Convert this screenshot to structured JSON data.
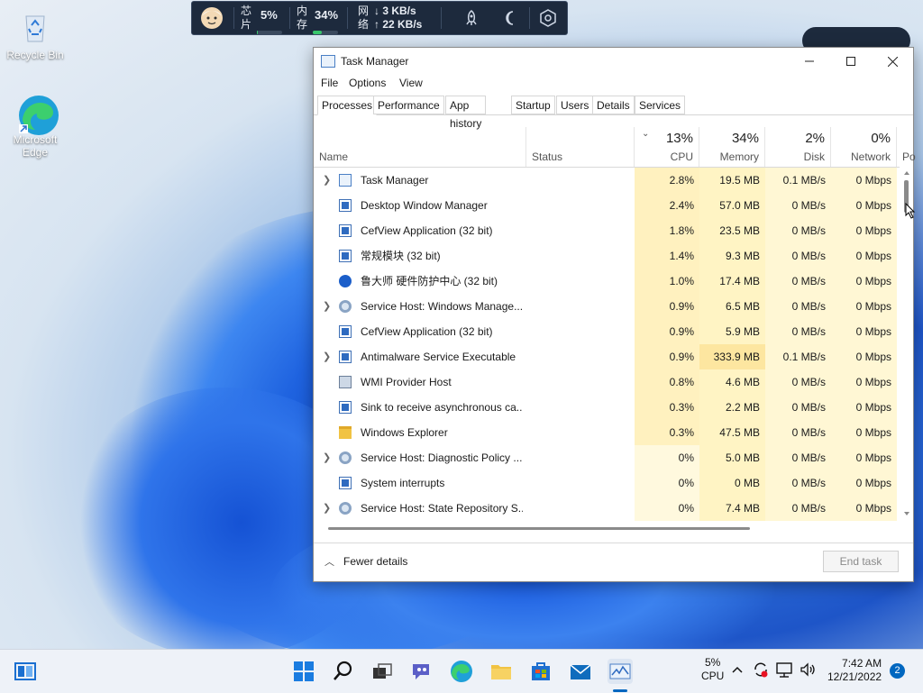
{
  "desktop": {
    "icons": [
      {
        "label": "Recycle Bin"
      },
      {
        "label": "Microsoft Edge"
      }
    ]
  },
  "monitor_bar": {
    "cpu_label_top": "芯",
    "cpu_label_bottom": "片",
    "cpu_value": "5%",
    "cpu_fraction": 0.05,
    "mem_label_top": "内",
    "mem_label_bottom": "存",
    "mem_value": "34%",
    "mem_fraction": 0.34,
    "net_label_top": "网",
    "net_label_bottom": "络",
    "net_down": "↓ 3 KB/s",
    "net_up": "↑ 22 KB/s",
    "icons": [
      "rocket-icon",
      "moon-icon",
      "settings-hex-icon"
    ]
  },
  "task_manager": {
    "title": "Task Manager",
    "menu": [
      "File",
      "Options",
      "View"
    ],
    "tabs": [
      "Processes",
      "Performance",
      "App history",
      "Startup",
      "Users",
      "Details",
      "Services"
    ],
    "active_tab": "Processes",
    "columns": {
      "name": "Name",
      "status": "Status",
      "cpu": {
        "pct": "13%",
        "label": "CPU"
      },
      "memory": {
        "pct": "34%",
        "label": "Memory"
      },
      "disk": {
        "pct": "2%",
        "label": "Disk"
      },
      "network": {
        "pct": "0%",
        "label": "Network"
      },
      "power_partial": "Po"
    },
    "processes": [
      {
        "name": "Task Manager",
        "cpu": "2.8%",
        "memory": "19.5 MB",
        "disk": "0.1 MB/s",
        "network": "0 Mbps",
        "expandable": true,
        "icon": "task-manager-icon"
      },
      {
        "name": "Desktop Window Manager",
        "cpu": "2.4%",
        "memory": "57.0 MB",
        "disk": "0 MB/s",
        "network": "0 Mbps",
        "expandable": false,
        "icon": "app-icon"
      },
      {
        "name": "CefView Application (32 bit)",
        "cpu": "1.8%",
        "memory": "23.5 MB",
        "disk": "0 MB/s",
        "network": "0 Mbps",
        "expandable": false,
        "icon": "app-icon"
      },
      {
        "name": "常规模块 (32 bit)",
        "cpu": "1.4%",
        "memory": "9.3 MB",
        "disk": "0 MB/s",
        "network": "0 Mbps",
        "expandable": false,
        "icon": "app-icon"
      },
      {
        "name": "鲁大师 硬件防护中心 (32 bit)",
        "cpu": "1.0%",
        "memory": "17.4 MB",
        "disk": "0 MB/s",
        "network": "0 Mbps",
        "expandable": false,
        "icon": "shield-icon"
      },
      {
        "name": "Service Host: Windows Manage...",
        "cpu": "0.9%",
        "memory": "6.5 MB",
        "disk": "0 MB/s",
        "network": "0 Mbps",
        "expandable": true,
        "icon": "gear-icon"
      },
      {
        "name": "CefView Application (32 bit)",
        "cpu": "0.9%",
        "memory": "5.9 MB",
        "disk": "0 MB/s",
        "network": "0 Mbps",
        "expandable": false,
        "icon": "app-icon"
      },
      {
        "name": "Antimalware Service Executable",
        "cpu": "0.9%",
        "memory": "333.9 MB",
        "disk": "0.1 MB/s",
        "network": "0 Mbps",
        "expandable": true,
        "icon": "app-icon"
      },
      {
        "name": "WMI Provider Host",
        "cpu": "0.8%",
        "memory": "4.6 MB",
        "disk": "0 MB/s",
        "network": "0 Mbps",
        "expandable": false,
        "icon": "wmi-icon"
      },
      {
        "name": "Sink to receive asynchronous ca...",
        "cpu": "0.3%",
        "memory": "2.2 MB",
        "disk": "0 MB/s",
        "network": "0 Mbps",
        "expandable": false,
        "icon": "app-icon"
      },
      {
        "name": "Windows Explorer",
        "cpu": "0.3%",
        "memory": "47.5 MB",
        "disk": "0 MB/s",
        "network": "0 Mbps",
        "expandable": false,
        "icon": "folder-icon"
      },
      {
        "name": "Service Host: Diagnostic Policy ...",
        "cpu": "0%",
        "memory": "5.0 MB",
        "disk": "0 MB/s",
        "network": "0 Mbps",
        "expandable": true,
        "icon": "gear-icon"
      },
      {
        "name": "System interrupts",
        "cpu": "0%",
        "memory": "0 MB",
        "disk": "0 MB/s",
        "network": "0 Mbps",
        "expandable": false,
        "icon": "app-icon"
      },
      {
        "name": "Service Host: State Repository S...",
        "cpu": "0%",
        "memory": "7.4 MB",
        "disk": "0 MB/s",
        "network": "0 Mbps",
        "expandable": true,
        "icon": "gear-icon"
      }
    ],
    "footer": {
      "fewer_details": "Fewer details",
      "end_task": "End task"
    }
  },
  "taskbar": {
    "apps": [
      "widgets-icon",
      "start-icon",
      "search-icon",
      "task-view-icon",
      "chat-icon",
      "edge-icon",
      "file-explorer-icon",
      "store-icon",
      "mail-icon",
      "task-manager-icon"
    ],
    "cpu_value": "5%",
    "cpu_label": "CPU",
    "time": "7:42 AM",
    "date": "12/21/2022",
    "notification_count": "2"
  },
  "colors": {
    "cpu_heat": "#fff4c4",
    "cpu_heat_strong": "#fdeaa3",
    "memory_heat_hot": "#fde6a0",
    "accent": "#0067c0"
  }
}
